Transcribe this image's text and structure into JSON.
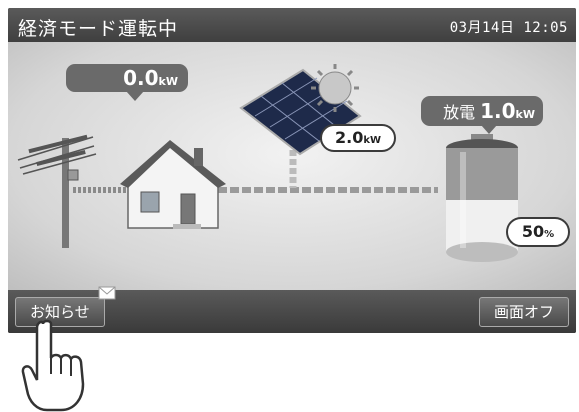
{
  "header": {
    "mode": "経済モード運転中",
    "datetime": "03月14日 12:05"
  },
  "grid": {
    "value": "0.0",
    "unit": "kW"
  },
  "solar": {
    "value": "2.0",
    "unit": "kW"
  },
  "battery": {
    "label": "放電",
    "value": "1.0",
    "unit": "kW",
    "charge_value": "50",
    "charge_unit": "%",
    "charge_fraction": 0.5
  },
  "footer": {
    "notice_label": "お知らせ",
    "screen_off_label": "画面オフ"
  },
  "icons": [
    "power-pole-icon",
    "house-icon",
    "solar-panel-icon",
    "sun-icon",
    "battery-icon",
    "mail-icon",
    "hand-pointer-icon"
  ],
  "colors": {
    "bar": "#4a4a4a",
    "bubble": "#6a6a6a",
    "panel": "#1e2a4a"
  }
}
